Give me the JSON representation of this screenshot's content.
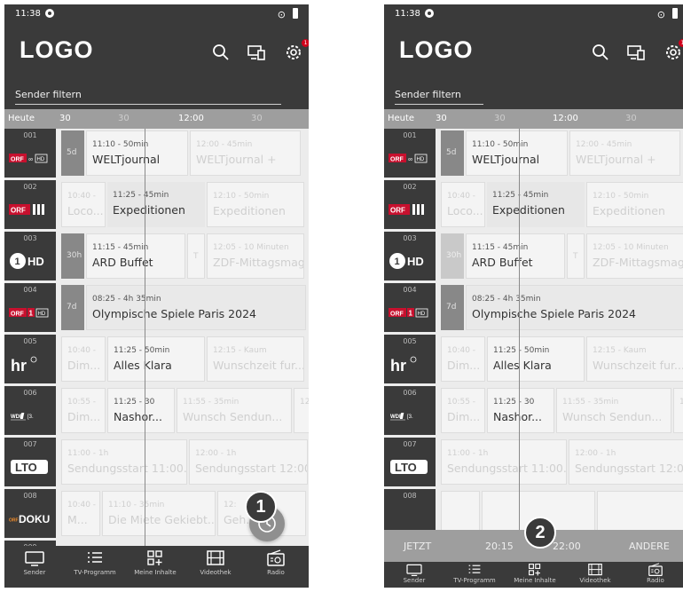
{
  "status": {
    "time": "11:38"
  },
  "header": {
    "logo": "LOGO",
    "notification_count": "1"
  },
  "filter": {
    "placeholder": "Sender filtern"
  },
  "timebar": {
    "today": "Heute",
    "t1": "30",
    "t2": "30",
    "t3": "12:00",
    "t4": "30"
  },
  "channels": [
    {
      "num": "001",
      "logo": "ORF 3sat HD",
      "programs": [
        {
          "time": "",
          "name": "5d"
        },
        {
          "time": "11:10 - 50min",
          "name": "WELTjournal"
        },
        {
          "time": "12:00 - 45min",
          "name": "WELTjournal +"
        }
      ]
    },
    {
      "num": "002",
      "logo": "ORF III",
      "programs": [
        {
          "time": "10:40 -",
          "name": "Loco..."
        },
        {
          "time": "11:25 - 45min",
          "name": "Expeditionen"
        },
        {
          "time": "12:10 - 50min",
          "name": "Expeditionen"
        }
      ]
    },
    {
      "num": "003",
      "logo": "1 HD",
      "programs": [
        {
          "time": "",
          "name": "30h"
        },
        {
          "time": "11:15 - 45min",
          "name": "ARD Buffet"
        },
        {
          "time": "",
          "name": "T"
        },
        {
          "time": "12:05 - 10 Minuten",
          "name": "ZDF-Mittagsmagazin"
        }
      ]
    },
    {
      "num": "004",
      "logo": "ORF 1 HD",
      "programs": [
        {
          "time": "",
          "name": "7d"
        },
        {
          "time": "08:25 - 4h 35min",
          "name": "Olympische Spiele Paris 2024"
        }
      ]
    },
    {
      "num": "005",
      "logo": "hr",
      "programs": [
        {
          "time": "10:40 -",
          "name": "Dim..."
        },
        {
          "time": "11:25 - 50min",
          "name": "Alles Klara"
        },
        {
          "time": "12:15 - Kaum",
          "name": "Wunschzeit fur..."
        }
      ]
    },
    {
      "num": "006",
      "logo": "WDR",
      "programs": [
        {
          "time": "10:55 -",
          "name": "Dim..."
        },
        {
          "time": "11:25 - 30",
          "name": "Nashor..."
        },
        {
          "time": "11:55 - 35min",
          "name": "Wunsch Sendun..."
        },
        {
          "time": "12:",
          "name": ""
        }
      ]
    },
    {
      "num": "007",
      "logo": "LTO",
      "programs": [
        {
          "time": "11:00 - 1h",
          "name": "Sendungsstart 11:00..."
        },
        {
          "time": "12:00 - 1h",
          "name": "Sendungsstart 12:00..."
        }
      ]
    },
    {
      "num": "008",
      "logo": "ORF DOKU",
      "programs": [
        {
          "time": "10:40 -",
          "name": "M..."
        },
        {
          "time": "11:10 - 35min",
          "name": "Die Miete Gekiebt..."
        },
        {
          "time": "12:",
          "name": "Geh..."
        }
      ]
    },
    {
      "num": "009",
      "logo": "",
      "programs": []
    }
  ],
  "nav": [
    {
      "label": "Sender",
      "icon": "tv-icon"
    },
    {
      "label": "TV-Programm",
      "icon": "list-icon"
    },
    {
      "label": "Meine Inhalte",
      "icon": "grid-plus-icon"
    },
    {
      "label": "Videothek",
      "icon": "film-icon"
    },
    {
      "label": "Radio",
      "icon": "radio-icon"
    }
  ],
  "callouts": {
    "one": "1",
    "two": "2"
  },
  "timeselect": {
    "now": "JETZT",
    "t1": "20:15",
    "t2": "22:00",
    "other": "ANDERE"
  },
  "colors": {
    "header": "#3a3a3a",
    "timebar": "#9e9e9e",
    "badge": "#d0021b"
  }
}
